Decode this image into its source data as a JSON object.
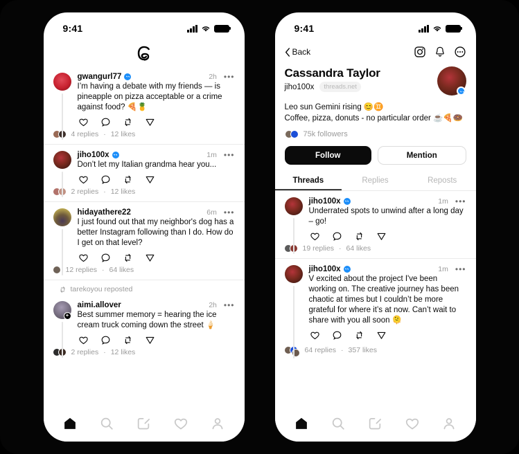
{
  "colors": {
    "background": "#050505",
    "phone_bg": "#ffffff",
    "text_primary": "#0b0b0b",
    "text_muted": "#9b9b9b",
    "verified_blue": "#1c8ef9",
    "accent_black": "#0b0b0b",
    "divider": "#eaeaea"
  },
  "left_phone": {
    "status_bar": {
      "time": "9:41",
      "icons": [
        "cellular-signal-icon",
        "wifi-icon",
        "battery-icon"
      ]
    },
    "header": {
      "logo": "threads-logo"
    },
    "feed": [
      {
        "username": "gwangurl77",
        "verified": true,
        "time": "2h",
        "menu": "•••",
        "text": "I’m having a debate with my friends — is pineapple on pizza acceptable or a crime against food? 🍕🍍",
        "replies": "4 replies",
        "likes": "12 likes",
        "separator": "·",
        "avatar_color": "#c7212f",
        "face_colors": [
          "#9a6a55",
          "#3d2f2a"
        ],
        "actions": [
          "like-icon",
          "reply-icon",
          "repost-icon",
          "share-icon"
        ]
      },
      {
        "username": "jiho100x",
        "verified": true,
        "time": "1m",
        "menu": "•••",
        "text": "Don’t let my Italian grandma hear you...",
        "replies": "2 replies",
        "likes": "12 likes",
        "separator": "·",
        "avatar_color": "#5a2018",
        "face_colors": [
          "#b2726a",
          "#c09183"
        ],
        "actions": [
          "like-icon",
          "reply-icon",
          "repost-icon",
          "share-icon"
        ]
      },
      {
        "username": "hidayathere22",
        "verified": false,
        "time": "6m",
        "menu": "•••",
        "text": "I just found out that my neighbor's dog has a better Instagram following than I do. How do I get on that level?",
        "replies": "12 replies",
        "likes": "64 likes",
        "separator": "·",
        "avatar_color": "#d8c651",
        "face_colors": [
          "#6f6257"
        ],
        "actions": [
          "like-icon",
          "reply-icon",
          "repost-icon",
          "share-icon"
        ]
      },
      {
        "repost_label": "tarekoyou reposted",
        "repost_icon": "repost-icon",
        "username": "aimi.allover",
        "verified": false,
        "time": "2h",
        "menu": "•••",
        "text": "Best summer memory = hearing the ice cream truck coming down the street 🍦",
        "replies": "2 replies",
        "likes": "12 likes",
        "separator": "·",
        "follow_badge": "+",
        "avatar_color": "#8a8296",
        "face_colors": [
          "#2c2c2c",
          "#3a2a22"
        ],
        "actions": [
          "like-icon",
          "reply-icon",
          "repost-icon",
          "share-icon"
        ]
      }
    ],
    "tabbar": [
      "home-icon",
      "search-icon",
      "compose-icon",
      "activity-heart-icon",
      "profile-icon"
    ],
    "tabbar_active": "home-icon"
  },
  "right_phone": {
    "status_bar": {
      "time": "9:41",
      "icons": [
        "cellular-signal-icon",
        "wifi-icon",
        "battery-icon"
      ]
    },
    "nav": {
      "back_label": "Back",
      "back_icon": "chevron-left-icon",
      "icons": [
        "instagram-icon",
        "bell-icon",
        "more-circle-icon"
      ]
    },
    "profile": {
      "full_name": "Cassandra Taylor",
      "handle": "jiho100x",
      "handle_pill": "threads.net",
      "verified": true,
      "bio_line1": "Leo sun Gemini rising 😊♊",
      "bio_line2": "Coffee, pizza, donuts - no particular order ☕🍕🍩",
      "followers": "75k followers",
      "follower_face_colors": [
        "#7a6a5c",
        "#1b4fd8"
      ]
    },
    "buttons": {
      "follow": "Follow",
      "mention": "Mention"
    },
    "tabs": [
      {
        "label": "Threads",
        "active": true
      },
      {
        "label": "Replies",
        "active": false
      },
      {
        "label": "Reposts",
        "active": false
      }
    ],
    "threads": [
      {
        "username": "jiho100x",
        "verified": true,
        "time": "1m",
        "menu": "•••",
        "text": "Underrated spots to unwind after a long day – go!",
        "replies": "19 replies",
        "likes": "64 likes",
        "separator": "·",
        "avatar_color": "#5a2018",
        "face_colors": [
          "#5b5b5b",
          "#8a3a33"
        ],
        "actions": [
          "like-icon",
          "reply-icon",
          "repost-icon",
          "share-icon"
        ]
      },
      {
        "username": "jiho100x",
        "verified": true,
        "time": "1m",
        "menu": "•••",
        "text": "V excited about the project I've been working on. The creative journey has been chaotic at times but I couldn’t be more grateful for where it’s at now. Can’t wait to share with you all soon 🫠",
        "replies": "64 replies",
        "likes": "357 likes",
        "separator": "·",
        "avatar_color": "#5a2018",
        "face_colors": [
          "#6f5e52",
          "#1b4fd8",
          "#6b5a4e"
        ],
        "actions": [
          "like-icon",
          "reply-icon",
          "repost-icon",
          "share-icon"
        ]
      }
    ],
    "tabbar": [
      "home-icon",
      "search-icon",
      "compose-icon",
      "activity-heart-icon",
      "profile-icon"
    ],
    "tabbar_active": "home-icon"
  }
}
